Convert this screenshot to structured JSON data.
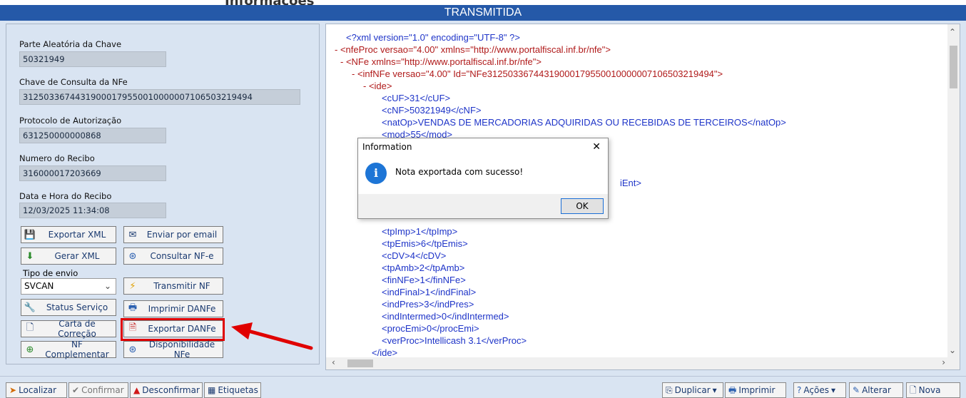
{
  "header": {
    "title": "TRANSMITIDA",
    "ghost_text": "Informações"
  },
  "fields": [
    {
      "label": "Parte Aleatória da Chave",
      "value": "50321949"
    },
    {
      "label": "Chave de Consulta da NFe",
      "value": "31250336744319000179550010000007106503219494"
    },
    {
      "label": "Protocolo de Autorização",
      "value": "631250000000868"
    },
    {
      "label": "Numero do Recibo",
      "value": "316000017203669"
    },
    {
      "label": "Data e Hora do Recibo",
      "value": "12/03/2025 11:34:08"
    }
  ],
  "buttons": {
    "exportar_xml": "Exportar XML",
    "enviar_email": "Enviar por email",
    "gerar_xml": "Gerar XML",
    "consultar_nfe": "Consultar NF-e",
    "tipo_envio_label": "Tipo de envio",
    "tipo_envio_value": "SVCAN",
    "transmitir_nf": "Transmitir NF",
    "status_servico": "Status Serviço",
    "imprimir_danfe": "Imprimir DANFe",
    "carta_correcao": "Carta de Correção",
    "exportar_danfe": "Exportar DANFe",
    "nf_complementar": "NF Complementar",
    "disponibilidade_nfe": "Disponibilidade NFe"
  },
  "xml_lines": [
    "<?xml version=\"1.0\" encoding=\"UTF-8\" ?>",
    "- <nfeProc versao=\"4.00\" xmlns=\"http://www.portalfiscal.inf.br/nfe\">",
    "- <NFe xmlns=\"http://www.portalfiscal.inf.br/nfe\">",
    "- <infNFe versao=\"4.00\" Id=\"NFe31250336744319000179550010000007106503219494\">",
    "- <ide>",
    "<cUF>31</cUF>",
    "<cNF>50321949</cNF>",
    "<natOp>VENDAS DE MERCADORIAS ADQUIRIDAS OU RECEBIDAS DE TERCEIROS</natOp>",
    "<mod>55</mod>",
    "iEnt>",
    "<tpImp>1</tpImp>",
    "<tpEmis>6</tpEmis>",
    "<cDV>4</cDV>",
    "<tpAmb>2</tpAmb>",
    "<finNFe>1</finNFe>",
    "<indFinal>1</indFinal>",
    "<indPres>3</indPres>",
    "<indIntermed>0</indIntermed>",
    "<procEmi>0</procEmi>",
    "<verProc>Intellicash 3.1</verProc>",
    "</ide>"
  ],
  "dialog": {
    "title": "Information",
    "close": "✕",
    "message": "Nota exportada com sucesso!",
    "ok": "OK"
  },
  "bottombar": {
    "localizar": "Localizar",
    "confirmar": "Confirmar",
    "desconfirmar": "Desconfirmar",
    "etiquetas": "Etiquetas",
    "duplicar": "Duplicar",
    "imprimir": "Imprimir",
    "acoes": "Ações",
    "alterar": "Alterar",
    "nova": "Nova"
  },
  "colors": {
    "titlebar": "#2559a8",
    "panel": "#d9e4f2",
    "highlight": "#e00000",
    "arrow": "#e00000",
    "xml_tag": "#1e34c8",
    "xml_value": "#c51a1a"
  }
}
